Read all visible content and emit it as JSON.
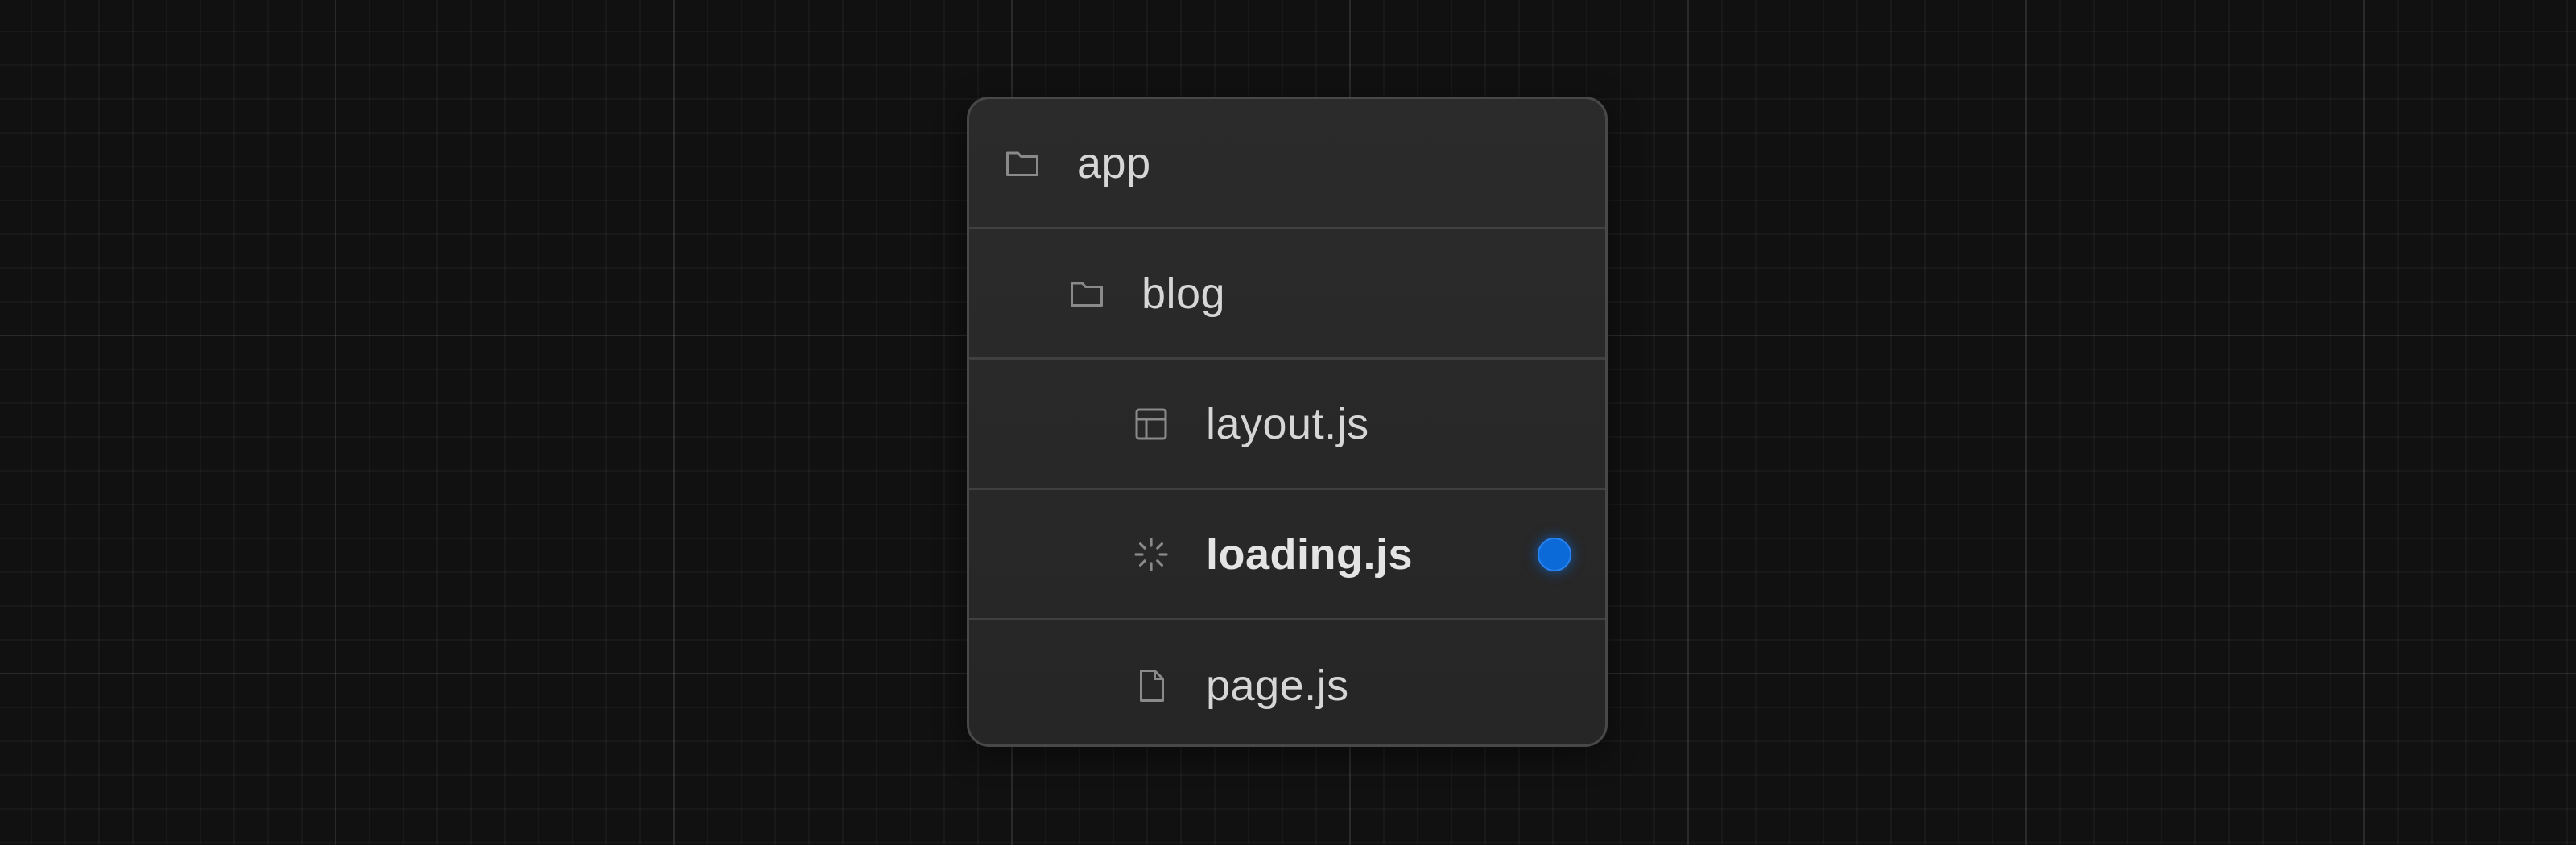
{
  "tree": {
    "items": [
      {
        "label": "app",
        "icon": "folder-icon",
        "level": 0
      },
      {
        "label": "blog",
        "icon": "folder-icon",
        "level": 1
      },
      {
        "label": "layout.js",
        "icon": "layout-icon",
        "level": 2
      },
      {
        "label": "loading.js",
        "icon": "loading-spinner-icon",
        "level": 2,
        "highlighted": true
      },
      {
        "label": "page.js",
        "icon": "file-icon",
        "level": 2
      }
    ]
  },
  "colors": {
    "background": "#111111",
    "panel": "#2a2a2a",
    "text": "#d6d6d6",
    "icon": "#8a8a8a",
    "indicator": "#0b6ad8"
  }
}
